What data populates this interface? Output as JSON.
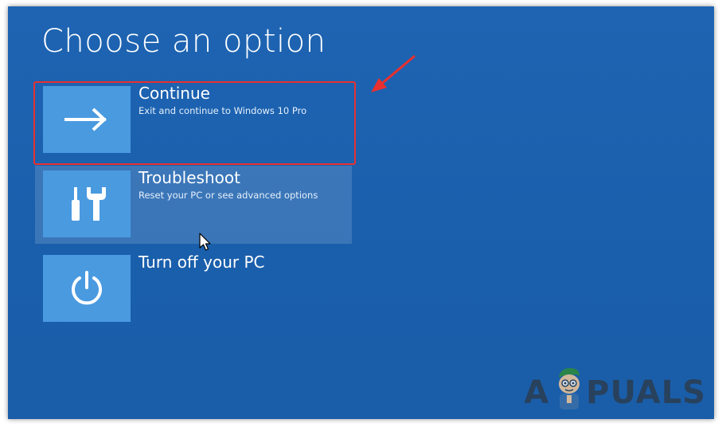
{
  "screen": {
    "title": "Choose an option"
  },
  "options": [
    {
      "id": "continue",
      "title": "Continue",
      "description": "Exit and continue to Windows 10 Pro",
      "icon": "arrow-right-icon"
    },
    {
      "id": "troubleshoot",
      "title": "Troubleshoot",
      "description": "Reset your PC or see advanced options",
      "icon": "tools-icon"
    },
    {
      "id": "turn-off",
      "title": "Turn off your PC",
      "description": "",
      "icon": "power-icon"
    }
  ],
  "annotation": {
    "highlight_color": "#e8302f",
    "highlighted_option": "continue"
  },
  "watermark": {
    "text_left": "A",
    "text_right": "PUALS"
  },
  "colors": {
    "background": "#1d63b0",
    "tile": "#4a9ae0",
    "text": "#ffffff"
  }
}
